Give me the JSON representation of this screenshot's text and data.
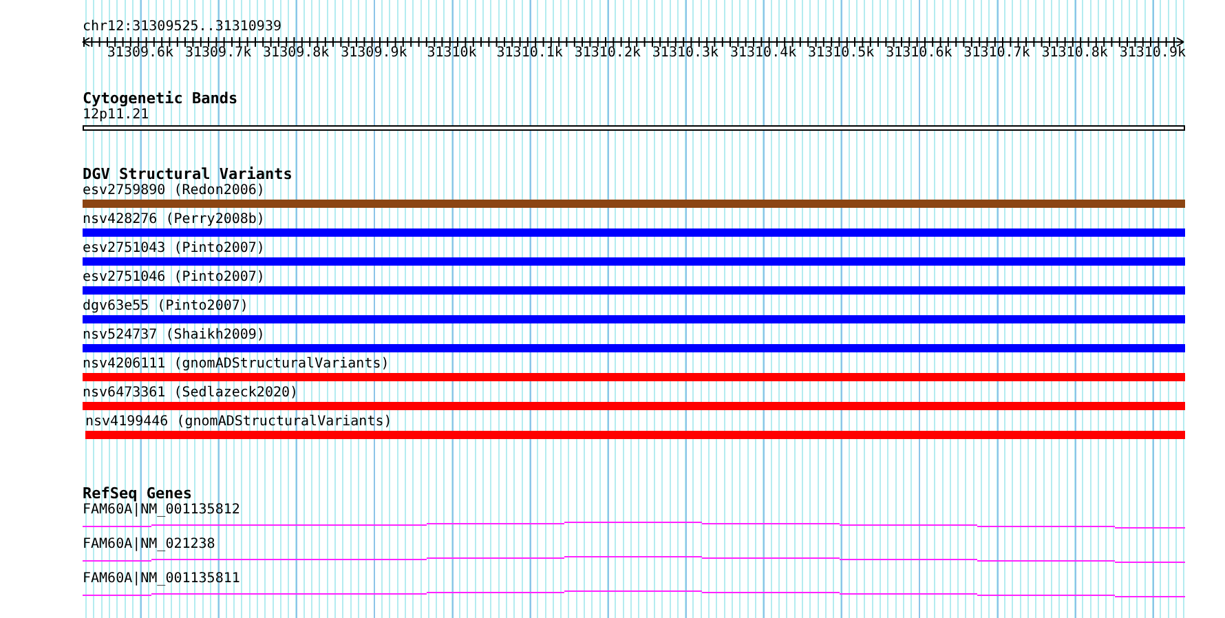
{
  "position": "chr12:31309525..31310939",
  "ruler": {
    "labels": [
      "31309.6k",
      "31309.7k",
      "31309.8k",
      "31309.9k",
      "31310k",
      "31310.1k",
      "31310.2k",
      "31310.3k",
      "31310.4k",
      "31310.5k",
      "31310.6k",
      "31310.7k",
      "31310.8k",
      "31310.9k"
    ]
  },
  "cytogenetic_bands": {
    "title": "Cytogenetic Bands",
    "band": "12p11.21"
  },
  "dgv": {
    "title": "DGV Structural Variants",
    "variants": [
      {
        "label": "esv2759890 (Redon2006)",
        "color": "#8b4513"
      },
      {
        "label": "nsv428276 (Perry2008b)",
        "color": "#0000ff"
      },
      {
        "label": "esv2751043 (Pinto2007)",
        "color": "#0000ff"
      },
      {
        "label": "esv2751046 (Pinto2007)",
        "color": "#0000ff"
      },
      {
        "label": "dgv63e55 (Pinto2007)",
        "color": "#0000ff"
      },
      {
        "label": "nsv524737 (Shaikh2009)",
        "color": "#0000ff"
      },
      {
        "label": "nsv4206111 (gnomADStructuralVariants)",
        "color": "#ff0000"
      },
      {
        "label": "nsv6473361 (Sedlazeck2020)",
        "color": "#ff0000"
      },
      {
        "label": "nsv4199446 (gnomADStructuralVariants)",
        "color": "#ff0000"
      }
    ]
  },
  "refseq": {
    "title": "RefSeq Genes",
    "genes": [
      {
        "label": "FAM60A|NM_001135812"
      },
      {
        "label": "FAM60A|NM_021238"
      },
      {
        "label": "FAM60A|NM_001135811"
      }
    ]
  }
}
